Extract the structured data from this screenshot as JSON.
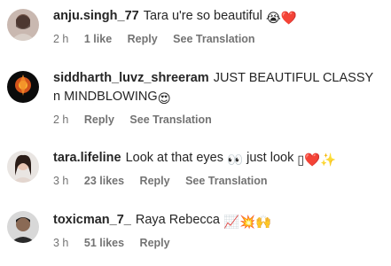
{
  "comments": [
    {
      "username": "anju.singh_77",
      "text": "Tara u're so beautiful",
      "emoji": "😭❤️",
      "time": "2 h",
      "likes": "1 like",
      "reply": "Reply",
      "translate": "See Translation"
    },
    {
      "username": "siddharth_luvz_shreeram",
      "text": "JUST BEAUTIFUL CLASSY n MINDBLOWING",
      "emoji": "😍",
      "time": "2 h",
      "likes": "",
      "reply": "Reply",
      "translate": "See Translation"
    },
    {
      "username": "tara.lifeline",
      "text": "Look at that eyes",
      "text2": "just look",
      "emoji_mid": "👀",
      "emoji": "▯❤️✨",
      "time": "3 h",
      "likes": "23 likes",
      "reply": "Reply",
      "translate": "See Translation"
    },
    {
      "username": "toxicman_7_",
      "text": "Raya Rebecca",
      "emoji": "📈💥🙌",
      "time": "3 h",
      "likes": "51 likes",
      "reply": "Reply"
    }
  ]
}
